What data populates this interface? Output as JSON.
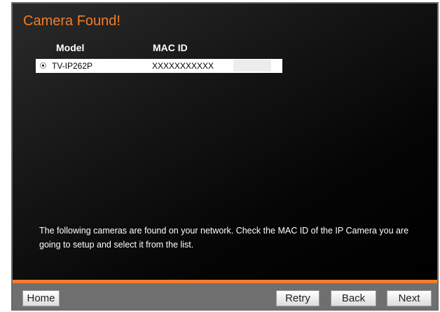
{
  "header": {
    "title": "Camera Found!"
  },
  "table": {
    "columns": [
      "Model",
      "MAC ID"
    ],
    "rows": [
      {
        "model": "TV-IP262P",
        "mac_id": "XXXXXXXXXXX",
        "selected": true
      }
    ]
  },
  "description": "The following cameras are found on your network. Check the MAC ID of the IP Camera you are going to setup and select it from the list.",
  "footer": {
    "home_label": "Home",
    "retry_label": "Retry",
    "back_label": "Back",
    "next_label": "Next"
  },
  "colors": {
    "accent": "#f07d2a",
    "panel_background": "#000000",
    "footer_background": "#6f6f6f"
  },
  "icons": {
    "row_selector": "radio-selected-icon"
  }
}
